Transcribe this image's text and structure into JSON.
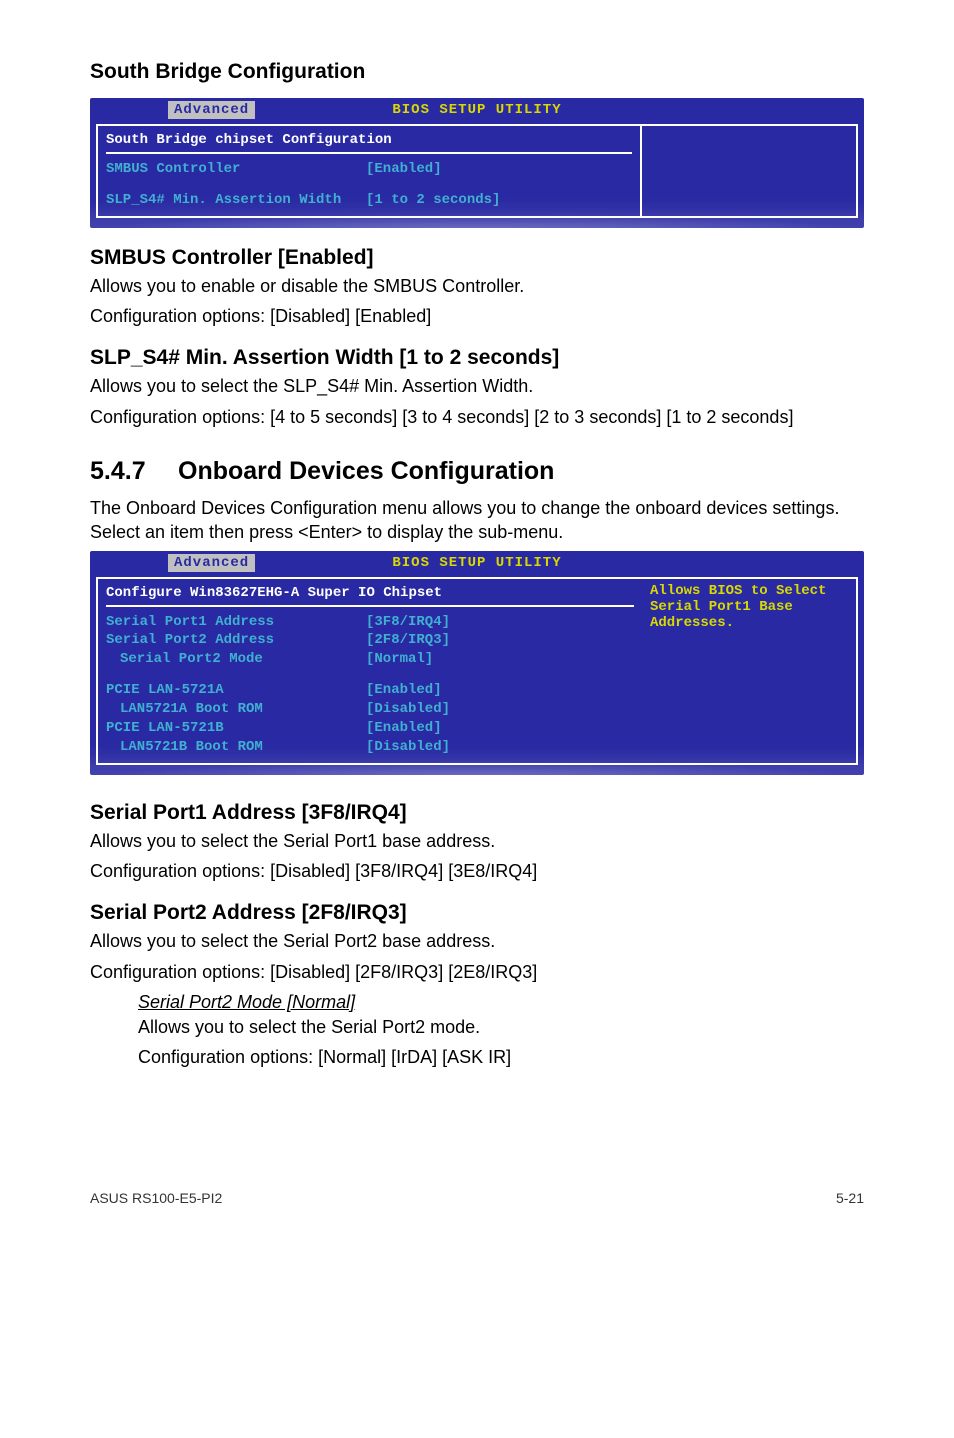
{
  "headings": {
    "south_bridge": "South Bridge Configuration",
    "smbus": "SMBUS Controller [Enabled]",
    "slp": "SLP_S4# Min. Assertion Width [1 to 2 seconds]",
    "onboard_num": "5.4.7",
    "onboard": "Onboard Devices Configuration",
    "sp1": "Serial Port1 Address [3F8/IRQ4]",
    "sp2": "Serial Port2 Address [2F8/IRQ3]",
    "sp2mode": "Serial Port2 Mode [Normal]"
  },
  "paragraphs": {
    "smbus1": "Allows you to enable or disable the SMBUS Controller.",
    "smbus2": "Configuration options: [Disabled] [Enabled]",
    "slp1": "Allows you to select the SLP_S4# Min. Assertion Width.",
    "slp2": "Configuration options: [4 to 5 seconds] [3 to 4 seconds] [2 to 3 seconds] [1 to 2 seconds]",
    "onboard1": "The Onboard Devices Configuration menu allows you to change the onboard devices settings. Select an item then press <Enter> to display the sub-menu.",
    "sp1a": "Allows you to select the Serial Port1 base address.",
    "sp1b": "Configuration options: [Disabled] [3F8/IRQ4] [3E8/IRQ4]",
    "sp2a": "Allows you to select the Serial Port2 base address.",
    "sp2b": "Configuration options: [Disabled] [2F8/IRQ3] [2E8/IRQ3]",
    "sp2mode_a": "Allows you to select the Serial Port2 mode.",
    "sp2mode_b": "Configuration options: [Normal] [IrDA] [ASK IR]"
  },
  "bios1": {
    "title": "BIOS SETUP UTILITY",
    "tab": "Advanced",
    "panel_title": "South Bridge chipset Configuration",
    "rows": [
      {
        "label": "SMBUS Controller",
        "value": "[Enabled]"
      },
      {
        "label": "SLP_S4# Min. Assertion Width",
        "value": "[1 to 2 seconds]"
      }
    ]
  },
  "bios2": {
    "title": "BIOS SETUP UTILITY",
    "tab": "Advanced",
    "panel_title": "Configure Win83627EHG-A Super IO Chipset",
    "help": "Allows BIOS to Select Serial Port1 Base Addresses.",
    "rows_a": [
      {
        "label": "Serial Port1 Address",
        "value": "[3F8/IRQ4]",
        "indent": false
      },
      {
        "label": "Serial Port2 Address",
        "value": "[2F8/IRQ3]",
        "indent": false
      },
      {
        "label": "Serial Port2 Mode",
        "value": "[Normal]",
        "indent": true
      }
    ],
    "rows_b": [
      {
        "label": "PCIE LAN-5721A",
        "value": "[Enabled]",
        "indent": false
      },
      {
        "label": "LAN5721A Boot ROM",
        "value": "[Disabled]",
        "indent": true
      },
      {
        "label": "PCIE LAN-5721B",
        "value": "[Enabled]",
        "indent": false
      },
      {
        "label": "LAN5721B Boot ROM",
        "value": "[Disabled]",
        "indent": true
      }
    ]
  },
  "footer": {
    "left": "ASUS RS100-E5-PI2",
    "right": "5-21"
  }
}
